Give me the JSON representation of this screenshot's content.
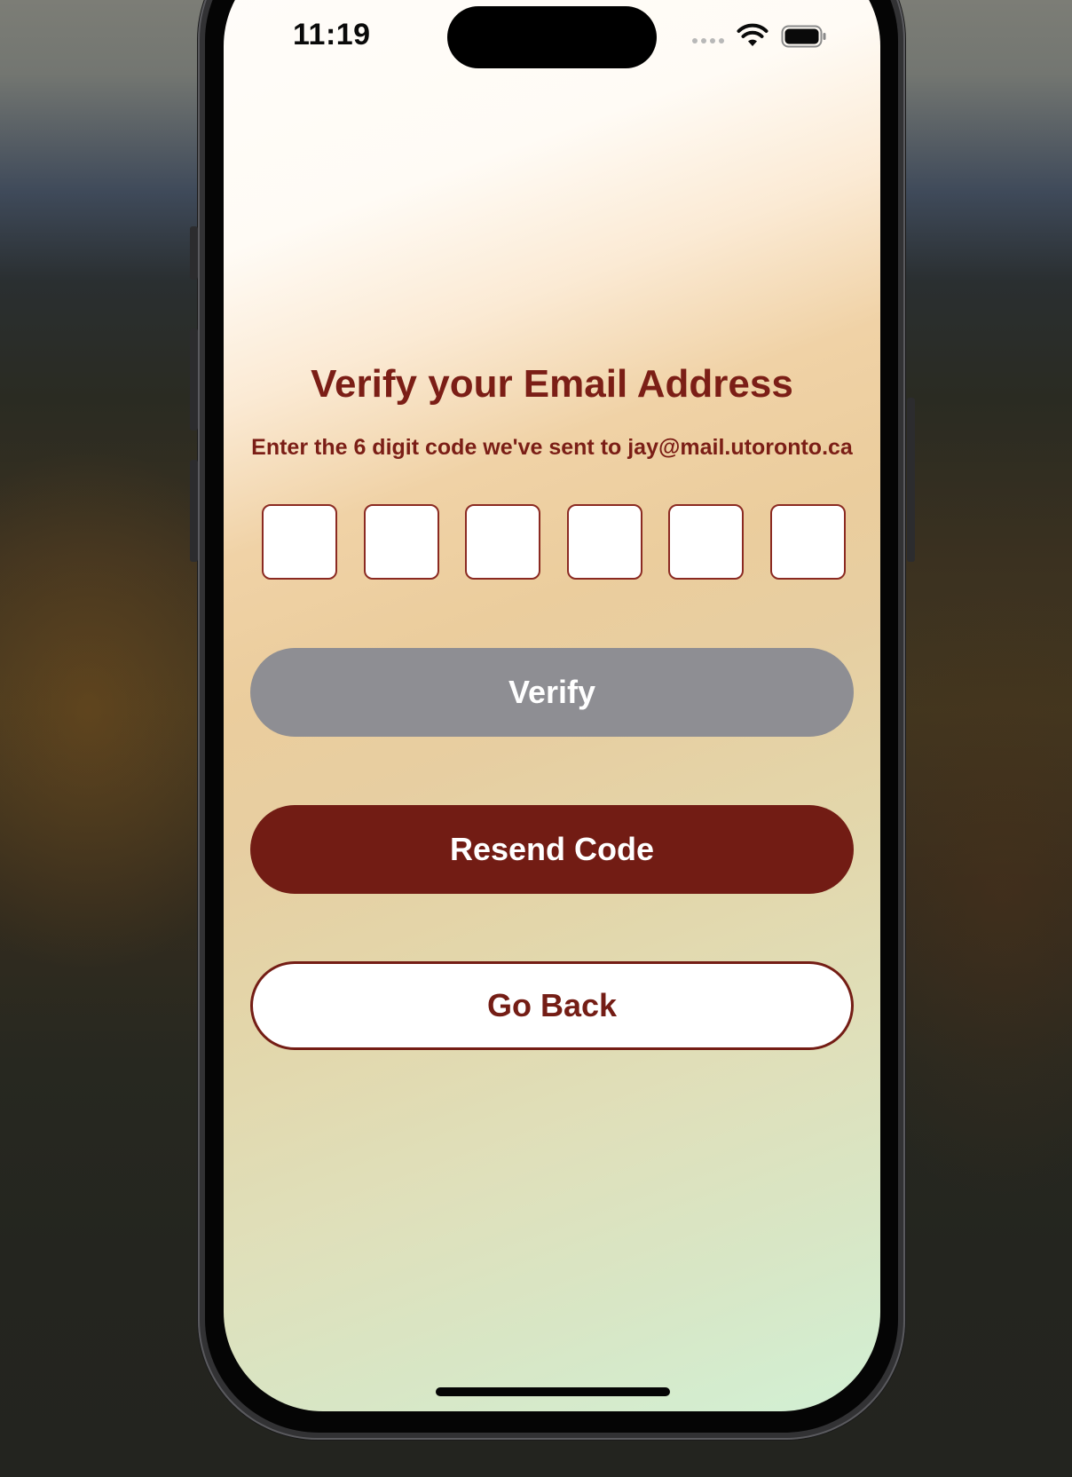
{
  "status_bar": {
    "time": "11:19",
    "icons": [
      "cellular-signal-icon",
      "wifi-icon",
      "battery-icon"
    ]
  },
  "verify_screen": {
    "title": "Verify your Email Address",
    "subtitle": "Enter the 6 digit code we've sent to jay@mail.utoronto.ca",
    "code_digits": [
      "",
      "",
      "",
      "",
      "",
      ""
    ],
    "verify_label": "Verify",
    "resend_label": "Resend Code",
    "back_label": "Go Back"
  },
  "colors": {
    "accent": "#721c14",
    "disabled_button": "#8e8e93",
    "text_accent": "#7b1e16"
  }
}
